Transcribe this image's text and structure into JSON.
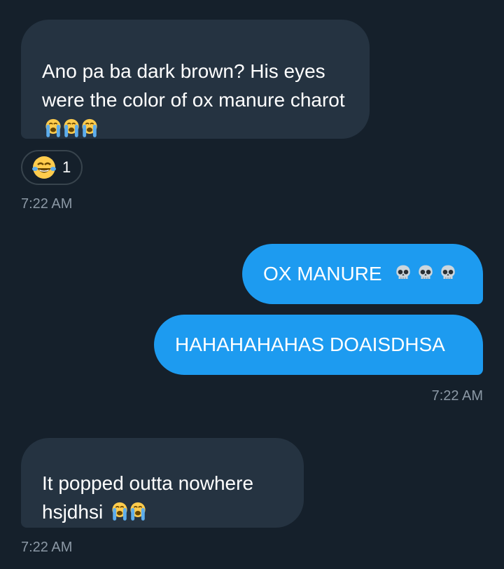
{
  "messages": [
    {
      "id": "msg1",
      "direction": "incoming",
      "text": "Ano pa ba dark brown? His eyes were the color of ox manure charot",
      "emojis": [
        "loudly-crying-face",
        "loudly-crying-face",
        "loudly-crying-face"
      ]
    },
    {
      "id": "msg2",
      "direction": "outgoing",
      "text": "OX MANURE",
      "emojis": [
        "skull",
        "skull",
        "skull"
      ]
    },
    {
      "id": "msg3",
      "direction": "outgoing",
      "text": "HAHAHAHAHAS DOAISDHSA",
      "emojis": []
    },
    {
      "id": "msg4",
      "direction": "incoming",
      "text": "It popped outta nowhere hsjdhsi",
      "emojis": [
        "loudly-crying-face",
        "loudly-crying-face"
      ]
    }
  ],
  "reaction": {
    "emoji": "face-with-tears-of-joy",
    "count": "1"
  },
  "timestamps": {
    "first": "7:22 AM",
    "second": "7:22 AM",
    "third": "7:22 AM"
  },
  "colors": {
    "background": "#15202b",
    "incoming_bubble": "#253341",
    "outgoing_bubble": "#1d9bf0",
    "timestamp": "#8b98a5"
  }
}
